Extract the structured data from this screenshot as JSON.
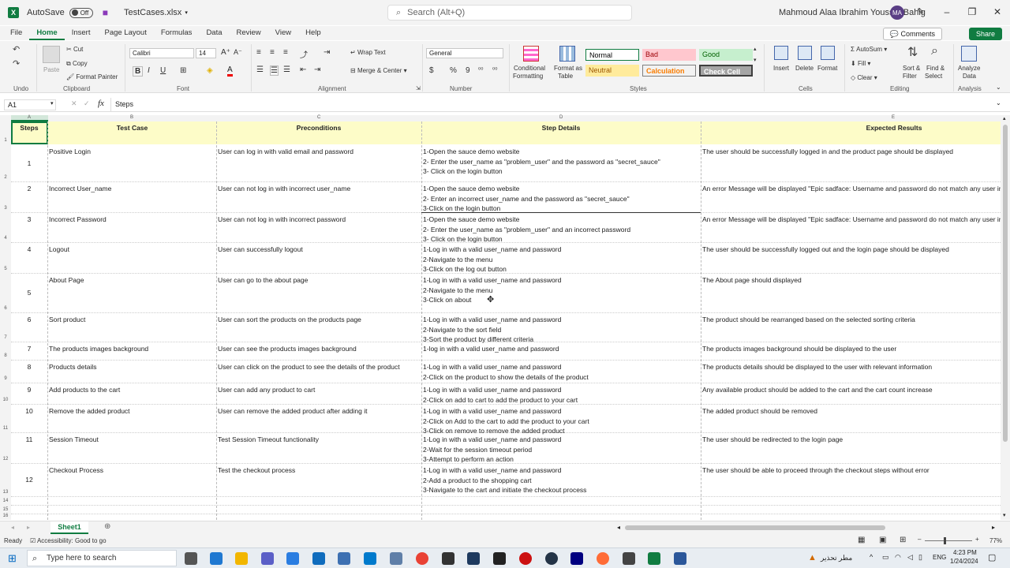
{
  "titlebar": {
    "autosave_label": "AutoSave",
    "autosave_state": "Off",
    "filename": "TestCases.xlsx",
    "search_placeholder": "Search (Alt+Q)",
    "user_name": "Mahmoud Alaa Ibrahim Youssef Bahig",
    "user_initials": "MA"
  },
  "menu": {
    "items": [
      "File",
      "Home",
      "Insert",
      "Page Layout",
      "Formulas",
      "Data",
      "Review",
      "View",
      "Help"
    ],
    "comments": "Comments",
    "share": "Share"
  },
  "ribbon": {
    "undo": "Undo",
    "clipboard": {
      "label": "Clipboard",
      "paste": "Paste",
      "cut": "Cut",
      "copy": "Copy",
      "format_painter": "Format Painter"
    },
    "font": {
      "label": "Font",
      "name": "Calibri",
      "size": "14"
    },
    "alignment": {
      "label": "Alignment",
      "wrap": "Wrap Text",
      "merge": "Merge & Center"
    },
    "number": {
      "label": "Number",
      "format": "General"
    },
    "styles": {
      "label": "Styles",
      "conditional": "Conditional",
      "conditional2": "Formatting",
      "format_as": "Format as",
      "table": "Table",
      "cells": [
        {
          "name": "Normal",
          "bg": "#ffffff",
          "fg": "#000000"
        },
        {
          "name": "Bad",
          "bg": "#ffc7ce",
          "fg": "#9c0006"
        },
        {
          "name": "Good",
          "bg": "#c6efce",
          "fg": "#006100"
        },
        {
          "name": "Neutral",
          "bg": "#ffeb9c",
          "fg": "#9c5700"
        },
        {
          "name": "Calculation",
          "bg": "#f2f2f2",
          "fg": "#fa7d00"
        },
        {
          "name": "Check Cell",
          "bg": "#a5a5a5",
          "fg": "#ffffff"
        }
      ]
    },
    "cells": {
      "label": "Cells",
      "insert": "Insert",
      "delete": "Delete",
      "format": "Format"
    },
    "editing": {
      "label": "Editing",
      "autosum": "AutoSum",
      "fill": "Fill",
      "clear": "Clear",
      "sort1": "Sort &",
      "sort2": "Filter",
      "find1": "Find &",
      "find2": "Select"
    },
    "analysis": {
      "label": "Analysis",
      "analyze1": "Analyze",
      "analyze2": "Data"
    }
  },
  "formula_bar": {
    "name_box": "A1",
    "fx": "fx",
    "content": "Steps"
  },
  "columns": [
    "A",
    "B",
    "C",
    "D",
    "E"
  ],
  "sheet": {
    "headers": [
      "Steps",
      "Test Case",
      "Preconditions",
      "Step Details",
      "Expected Results"
    ],
    "rows": [
      {
        "n": "1",
        "case": "Positive Login",
        "pre": "User can log in with valid email and password",
        "steps": [
          "1-Open the sauce demo website",
          "2- Enter the user_name as \"problem_user\" and the password as \"secret_sauce\"",
          "3- Click on the login button"
        ],
        "exp": "The user should be successfully logged in and the product page should be displayed"
      },
      {
        "n": "2",
        "case": "Incorrect User_name",
        "pre": "User can not log in with incorrect user_name",
        "steps": [
          "1-Open the sauce demo website",
          "2- Enter an incorrect user_name and the password as \"secret_sauce\"",
          "3-Click on the login button"
        ],
        "exp": "An error Message will be displayed \"Epic sadface: Username and password do not match any user in"
      },
      {
        "n": "3",
        "case": "Incorrect Password",
        "pre": "User can not log in with incorrect password",
        "steps": [
          "1-Open the sauce demo website",
          "2- Enter the user_name as \"problem_user\" and an incorrect password",
          "3- Click on the login button"
        ],
        "exp": "An error Message will be displayed \"Epic sadface: Username and password do not match any user in"
      },
      {
        "n": "4",
        "case": "Logout",
        "pre": "User can successfully logout",
        "steps": [
          "1-Log in with a valid user_name and password",
          "2-Navigate to the menu",
          "3-Click on the log out button"
        ],
        "exp": "The user should be successfully logged out and the login page should be displayed"
      },
      {
        "n": "5",
        "case": "About Page",
        "pre": "User can go to the about page",
        "steps": [
          "1-Log in with a valid user_name and password",
          "2-Navigate to the menu",
          "3-Click on about"
        ],
        "exp": "The About page should displayed"
      },
      {
        "n": "6",
        "case": "Sort product",
        "pre": "User can sort the products on the products page",
        "steps": [
          "1-Log in with a valid user_name and password",
          "2-Navigate to the sort field",
          "3-Sort the product by different criteria"
        ],
        "exp": "The product should be rearranged based on the selected sorting criteria"
      },
      {
        "n": "7",
        "case": "The products images background",
        "pre": "User can see the products images background",
        "steps": [
          "1-log in with a valid user_name and password"
        ],
        "exp": "The products images  background should be displayed to the user"
      },
      {
        "n": "8",
        "case": "Products details",
        "pre": "User can click on the product to see the details of the product",
        "steps": [
          "1-Log in with a valid user_name and password",
          "2-Click on the product to show the details of the product"
        ],
        "exp": "The products details should be displayed to the user with relevant information"
      },
      {
        "n": "9",
        "case": "Add products to the cart",
        "pre": "User can add any product to cart",
        "steps": [
          "1-Log in with a valid user_name and password",
          "2-Click on add to cart to add the product to your cart"
        ],
        "exp": "Any available product should be added to the cart and the cart count increase"
      },
      {
        "n": "10",
        "case": "Remove the added product",
        "pre": "User can remove the added product after adding it",
        "steps": [
          "1-Log in with a valid user_name and password",
          "2-Click on Add to the cart to add the product to your cart",
          "3-Click on remove to remove the added product"
        ],
        "exp": "The added product should be removed"
      },
      {
        "n": "11",
        "case": "Session Timeout",
        "pre": "Test Session Timeout functionality",
        "steps": [
          "1-Log in with a valid user_name and password",
          "2-Wait for the session timeout period",
          "3-Attempt to perform an action"
        ],
        "exp": "The user should be redirected to the login page"
      },
      {
        "n": "12",
        "case": "Checkout Process",
        "pre": "Test the checkout process",
        "steps": [
          "1-Log in with a valid user_name and password",
          "2-Add a product to the shopping cart",
          "3-Navigate to the cart and initiate the checkout process"
        ],
        "exp": "The user should be able to proceed through the checkout steps without error"
      }
    ],
    "row_numbers": [
      "1",
      "2",
      "3",
      "4",
      "5",
      "6",
      "7",
      "8",
      "9",
      "10",
      "11",
      "12",
      "13",
      "14",
      "15",
      "16"
    ]
  },
  "sheet_tabs": {
    "active": "Sheet1"
  },
  "status": {
    "ready": "Ready",
    "accessibility": "Accessibility: Good to go",
    "zoom": "77%"
  },
  "taskbar": {
    "search": "Type here to search",
    "weather": "مطر تحذير",
    "lang": "ENG",
    "time": "4:23 PM",
    "date": "1/24/2024"
  }
}
